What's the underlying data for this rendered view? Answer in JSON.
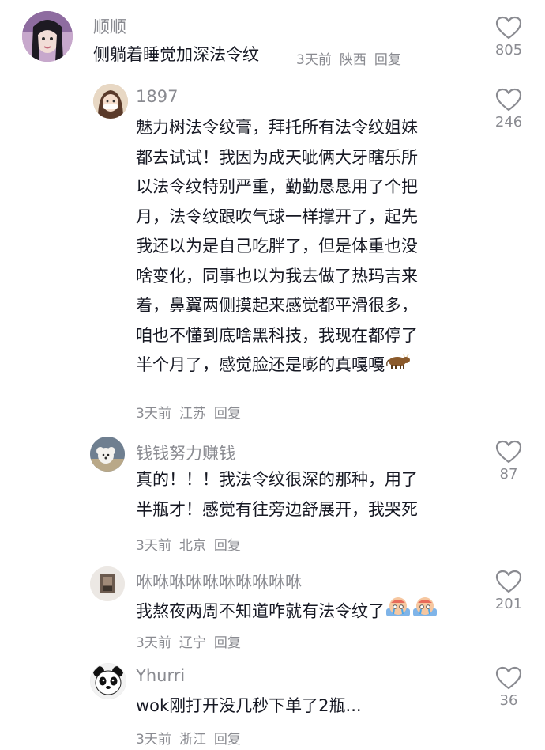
{
  "comments": [
    {
      "username": "顺顺",
      "text_lines": [
        "侧躺着睡觉加深法令纹"
      ],
      "time": "3天前",
      "location": "陕西",
      "reply_label": "回复",
      "likes": "805",
      "avatar_icon": "avatar-girl-purple"
    },
    {
      "username": "1897",
      "text_lines": [
        "魅力树法令纹膏，拜托所有法令纹姐妹",
        "都去试试！我因为成天呲俩大牙瞎乐所",
        "以法令纹特别严重，勤勤恳恳用了个把",
        "月，法令纹跟吹气球一样撑开了，起先",
        "我还以为是自己吃胖了，但是体重也没",
        "啥变化，同事也以为我去做了热玛吉来",
        "着，鼻翼两侧摸起来感觉都平滑很多，",
        "咱也不懂到底啥黑科技，我现在都停了",
        "半个月了，感觉脸还是嘭的真嘎嘎"
      ],
      "trailing_emoji": "cow-emoji",
      "time": "3天前",
      "location": "江苏",
      "reply_label": "回复",
      "likes": "246",
      "avatar_icon": "avatar-illustrated-girl"
    },
    {
      "username": "钱钱努力赚钱",
      "text_lines": [
        "真的！！！我法令纹很深的那种，用了",
        "半瓶才！感觉有往旁边舒展开，我哭死"
      ],
      "time": "3天前",
      "location": "北京",
      "reply_label": "回复",
      "likes": "87",
      "avatar_icon": "avatar-dog"
    },
    {
      "username": "咻咻咻咻咻咻咻咻咻咻",
      "text_lines": [
        "我熬夜两周不知道咋就有法令纹了"
      ],
      "trailing_emoji": "crying-face-emoji",
      "time": "3天前",
      "location": "辽宁",
      "reply_label": "回复",
      "likes": "201",
      "avatar_icon": "avatar-photo"
    },
    {
      "username": "Yhurri",
      "text_lines": [
        "wok刚打开没几秒下单了2瓶..."
      ],
      "time": "3天前",
      "location": "浙江",
      "reply_label": "回复",
      "likes": "36",
      "avatar_icon": "avatar-panda"
    }
  ],
  "colors": {
    "text": "#161823",
    "secondary": "#8a8b91",
    "background": "#ffffff"
  }
}
